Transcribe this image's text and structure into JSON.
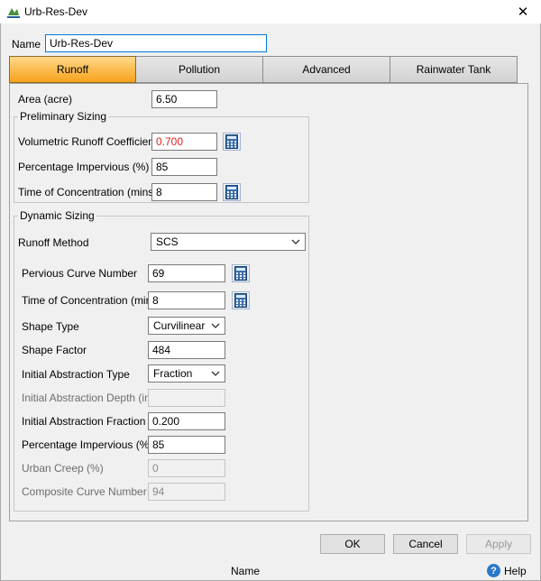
{
  "window": {
    "title": "Urb-Res-Dev",
    "close_glyph": "✕",
    "app_icon": "app-icon"
  },
  "name": {
    "label": "Name",
    "value": "Urb-Res-Dev"
  },
  "tabs": [
    {
      "label": "Runoff",
      "active": true
    },
    {
      "label": "Pollution",
      "active": false
    },
    {
      "label": "Advanced",
      "active": false
    },
    {
      "label": "Rainwater Tank",
      "active": false
    }
  ],
  "runoff": {
    "area": {
      "label": "Area (acre)",
      "value": "6.50"
    },
    "preliminary": {
      "title": "Preliminary Sizing",
      "volumetric_coeff": {
        "label": "Volumetric Runoff Coefficient",
        "value": "0.700"
      },
      "pct_impervious": {
        "label": "Percentage Impervious (%)",
        "value": "85"
      },
      "time_conc": {
        "label": "Time of Concentration (mins)",
        "value": "8"
      }
    },
    "dynamic": {
      "title": "Dynamic Sizing",
      "runoff_method": {
        "label": "Runoff Method",
        "value": "SCS"
      },
      "pervious_cn": {
        "label": "Pervious Curve Number",
        "value": "69"
      },
      "time_conc": {
        "label": "Time of Concentration (mins)",
        "value": "8"
      },
      "shape_type": {
        "label": "Shape Type",
        "value": "Curvilinear"
      },
      "shape_factor": {
        "label": "Shape Factor",
        "value": "484"
      },
      "ia_type": {
        "label": "Initial Abstraction Type",
        "value": "Fraction"
      },
      "ia_depth": {
        "label": "Initial Abstraction Depth (in)",
        "value": ""
      },
      "ia_fraction": {
        "label": "Initial Abstraction Fraction",
        "value": "0.200"
      },
      "pct_impervious": {
        "label": "Percentage Impervious (%)",
        "value": "85"
      },
      "urban_creep": {
        "label": "Urban Creep (%)",
        "value": "0"
      },
      "composite_cn": {
        "label": "Composite Curve Number",
        "value": "94"
      }
    }
  },
  "buttons": {
    "ok": "OK",
    "cancel": "Cancel",
    "apply": "Apply"
  },
  "status": {
    "text": "Name",
    "help": "Help",
    "help_glyph": "?"
  },
  "colors": {
    "active_tab": "#f7a21b",
    "error_value": "#e02020",
    "focus_border": "#0078d7"
  }
}
